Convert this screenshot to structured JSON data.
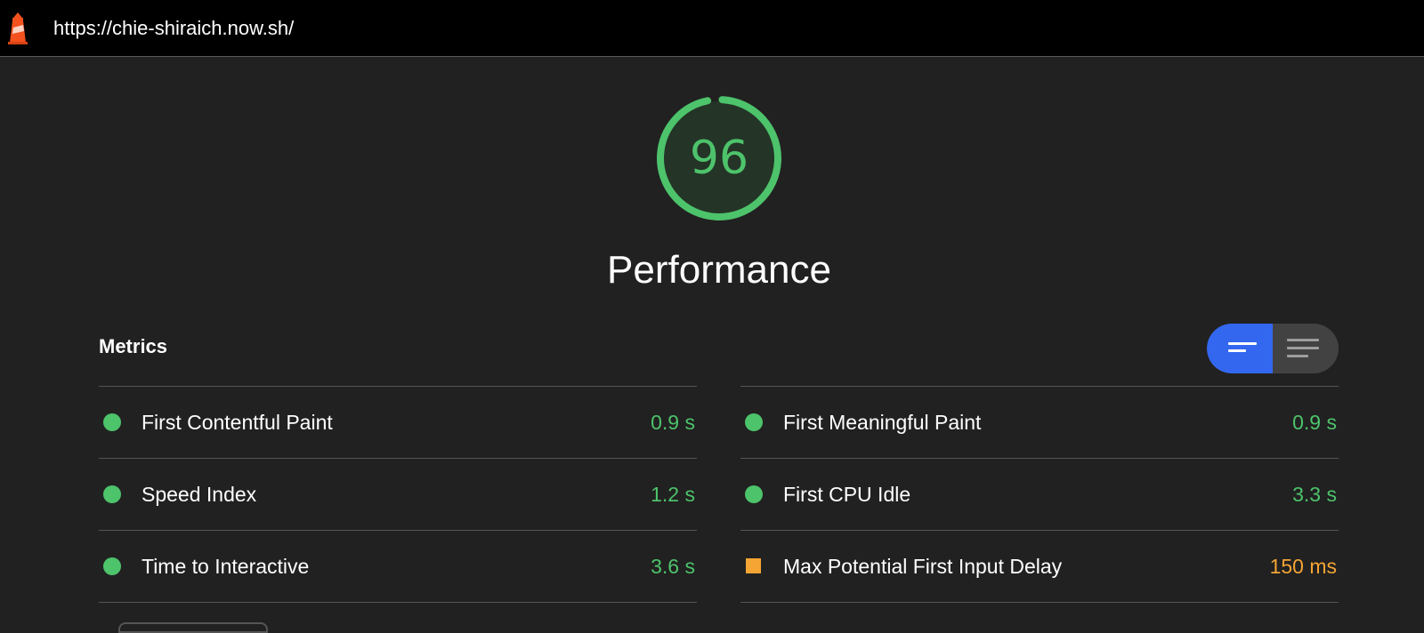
{
  "address_bar": {
    "url": "https://chie-shiraich.now.sh/"
  },
  "score": {
    "value": "96",
    "fraction": 0.96,
    "color": "#4dc36b"
  },
  "category": {
    "title": "Performance"
  },
  "metrics_section": {
    "title": "Metrics"
  },
  "colors": {
    "pass": "#4dc36b",
    "average": "#f5a534",
    "toggle_active": "#3367f0",
    "background": "#212121"
  },
  "metrics": {
    "left": [
      {
        "label": "First Contentful Paint",
        "value": "0.9 s",
        "status": "pass"
      },
      {
        "label": "Speed Index",
        "value": "1.2 s",
        "status": "pass"
      },
      {
        "label": "Time to Interactive",
        "value": "3.6 s",
        "status": "pass"
      }
    ],
    "right": [
      {
        "label": "First Meaningful Paint",
        "value": "0.9 s",
        "status": "pass"
      },
      {
        "label": "First CPU Idle",
        "value": "3.3 s",
        "status": "pass"
      },
      {
        "label": "Max Potential First Input Delay",
        "value": "150 ms",
        "status": "average"
      }
    ]
  },
  "view_toggle": {
    "selected": "compact",
    "options": [
      "compact-view-icon",
      "expanded-view-icon"
    ]
  }
}
